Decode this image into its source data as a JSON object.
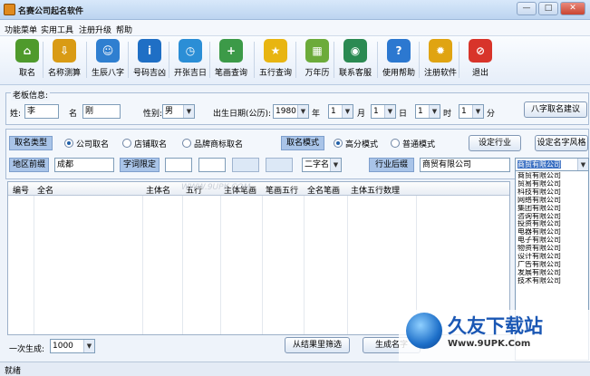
{
  "app": {
    "title": "名赛公司起名软件"
  },
  "menu": [
    "功能菜单",
    "实用工具",
    "注册升级",
    "帮助"
  ],
  "toolbar": [
    {
      "label": "取名",
      "icon": "house-icon",
      "color": "#4f9a2c"
    },
    {
      "label": "名称测算",
      "icon": "download-arrow-icon",
      "color": "#d99b14"
    },
    {
      "label": "生辰八字",
      "icon": "people-icon",
      "color": "#2f7fd0"
    },
    {
      "label": "号码吉凶",
      "icon": "info-icon",
      "color": "#1f6fc5"
    },
    {
      "label": "开张吉日",
      "icon": "clock-icon",
      "color": "#2b8ed6"
    },
    {
      "label": "笔画查询",
      "icon": "document-plus-icon",
      "color": "#3c9a48"
    },
    {
      "label": "五行查询",
      "icon": "star-icon",
      "color": "#e8b511"
    },
    {
      "label": "万年历",
      "icon": "calendar-icon",
      "color": "#6cab3a"
    },
    {
      "label": "联系客服",
      "icon": "globe-icon",
      "color": "#2b8a52"
    },
    {
      "label": "使用帮助",
      "icon": "help-icon",
      "color": "#2c78d0"
    },
    {
      "label": "注册软件",
      "icon": "gear-icon",
      "color": "#e0a412"
    },
    {
      "label": "退出",
      "icon": "stop-icon",
      "color": "#d8342a"
    }
  ],
  "info": {
    "legend": "老板信息:",
    "surname_label": "姓:",
    "surname": "李",
    "name_label": "名",
    "name": "刚",
    "gender_label": "性别:",
    "gender": "男",
    "birth_label": "出生日期(公历):",
    "year": "1980",
    "year_unit": "年",
    "month": "1",
    "month_unit": "月",
    "day": "1",
    "day_unit": "日",
    "hour": "1",
    "hour_unit": "时",
    "minute": "1",
    "minute_unit": "分",
    "bazi_button": "八字取名建议"
  },
  "options": {
    "type_tag": "取名类型",
    "type_options": [
      "公司取名",
      "店铺取名",
      "品牌商标取名"
    ],
    "mode_tag": "取名模式",
    "mode_options": [
      "高分模式",
      "普通模式"
    ],
    "industry_button": "设定行业",
    "style_button": "设定名字风格",
    "region_tag": "地区前缀",
    "region_value": "成都",
    "char_tag": "字词限定",
    "char_count": "二字名",
    "suffix_tag": "行业后缀",
    "suffix_value": "商贸有限公司",
    "combo_value": "商贸有限公司"
  },
  "grid": {
    "columns": [
      "编号",
      "全名",
      "主体名",
      "五行",
      "主体笔画",
      "笔画五行",
      "全名笔画",
      "主体五行数理"
    ]
  },
  "listbox": [
    "商贸有限公司",
    "贸易有限公司",
    "科技有限公司",
    "网络有限公司",
    "集团有限公司",
    "咨询有限公司",
    "投资有限公司",
    "电器有限公司",
    "电子有限公司",
    "物资有限公司",
    "设计有限公司",
    "广告有限公司",
    "发展有限公司",
    "技术有限公司"
  ],
  "bottom": {
    "gen_label": "一次生成:",
    "gen_count": "1000",
    "filter_button": "从结果里筛选",
    "generate_button": "生成名字"
  },
  "status": "就绪",
  "watermark": {
    "brand": "久友下载站",
    "url": "Www.9UPK.Com",
    "mid": "WWW.9UPK.COM"
  }
}
